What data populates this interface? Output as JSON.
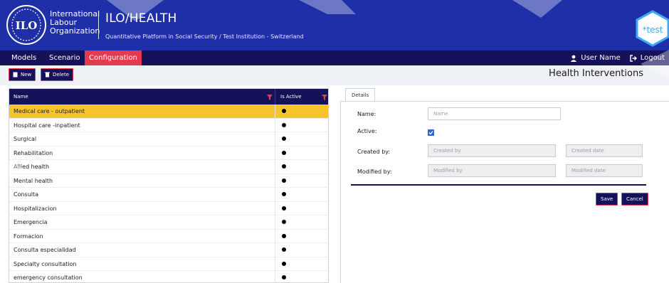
{
  "header": {
    "org_name_lines": [
      "International",
      "Labour",
      "Organization"
    ],
    "app_title": "ILO/HEALTH",
    "app_subtitle": "Quantitative Platform in Social Security / Test Institution - Switzerland",
    "badge_text": "*test"
  },
  "nav": {
    "items": [
      {
        "label": "Models",
        "active": false
      },
      {
        "label": "Scenario",
        "active": false
      },
      {
        "label": "Configuration",
        "active": true
      }
    ],
    "user_label": "User Name",
    "logout_label": "Logout"
  },
  "toolbar": {
    "new_label": "New",
    "delete_label": "Delete"
  },
  "page_title": "Health Interventions",
  "grid": {
    "columns": [
      "Name",
      "Is Active"
    ],
    "rows": [
      {
        "name": "Medical care - outpatient",
        "active": true,
        "selected": true
      },
      {
        "name": "Hospital care -inpatient",
        "active": true,
        "selected": false
      },
      {
        "name": "Surgical",
        "active": true,
        "selected": false
      },
      {
        "name": "Rehabilitation",
        "active": true,
        "selected": false
      },
      {
        "name": "Allied health",
        "active": true,
        "selected": false
      },
      {
        "name": "Mental health",
        "active": true,
        "selected": false
      },
      {
        "name": "Consulta",
        "active": true,
        "selected": false
      },
      {
        "name": "Hospitalizacion",
        "active": true,
        "selected": false
      },
      {
        "name": "Emergencia",
        "active": true,
        "selected": false
      },
      {
        "name": "Formacion",
        "active": true,
        "selected": false
      },
      {
        "name": "Consulta especialidad",
        "active": true,
        "selected": false
      },
      {
        "name": "Specialty consultation",
        "active": true,
        "selected": false
      },
      {
        "name": "emergency consultation",
        "active": true,
        "selected": false
      }
    ]
  },
  "details": {
    "tab_label": "Details",
    "name_label": "Name:",
    "name_placeholder": "Name",
    "active_label": "Active:",
    "active_checked": true,
    "created_by_label": "Created by:",
    "created_by_placeholder": "Created by",
    "created_date_placeholder": "Created date",
    "modified_by_label": "Modified by:",
    "modified_by_placeholder": "Modified by",
    "modified_date_placeholder": "Modified date",
    "save_label": "Save",
    "cancel_label": "Cancel"
  },
  "colors": {
    "header_bg": "#1e2fa8",
    "nav_bg": "#15125a",
    "accent_red": "#e23a4f",
    "selected_row": "#f8c42c"
  }
}
